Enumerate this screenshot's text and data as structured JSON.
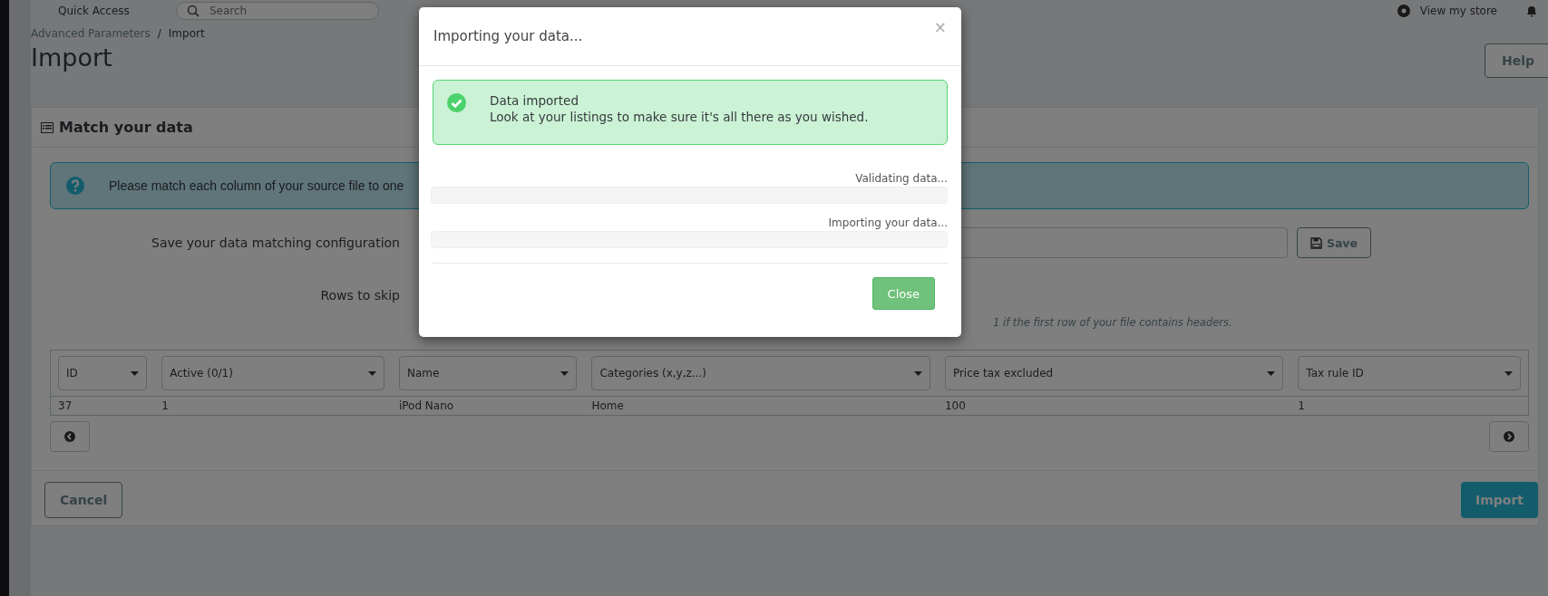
{
  "header": {
    "quick_access": "Quick Access",
    "search": {
      "placeholder": "Search"
    },
    "view_store": "View my store"
  },
  "breadcrumb": [
    "Advanced Parameters",
    "Import"
  ],
  "breadcrumb_separator": "/",
  "page_title": "Import",
  "help_button": "Help",
  "panel": {
    "title": "Match your data",
    "info": "Please match each column of your source file to one",
    "save_label": "Save your data matching configuration",
    "save_button": "Save",
    "rows_label": "Rows to skip",
    "rows_hint": "1 if the first row of your file contains headers.",
    "columns": [
      {
        "label": "ID"
      },
      {
        "label": "Active (0/1)"
      },
      {
        "label": "Name"
      },
      {
        "label": "Categories (x,y,z...)"
      },
      {
        "label": "Price tax excluded"
      },
      {
        "label": "Tax rule ID"
      }
    ],
    "row": [
      "37",
      "1",
      "iPod Nano",
      "Home",
      "100",
      "1"
    ],
    "cancel_button": "Cancel",
    "import_button": "Import"
  },
  "modal": {
    "title": "Importing your data...",
    "close_x": "×",
    "alert": {
      "title": "Data imported",
      "message": "Look at your listings to make sure it's all there as you wished."
    },
    "progress": [
      {
        "label": "Validating data...",
        "level": 0
      },
      {
        "label": "Importing your data...",
        "level": 0
      }
    ],
    "close_button": "Close"
  }
}
